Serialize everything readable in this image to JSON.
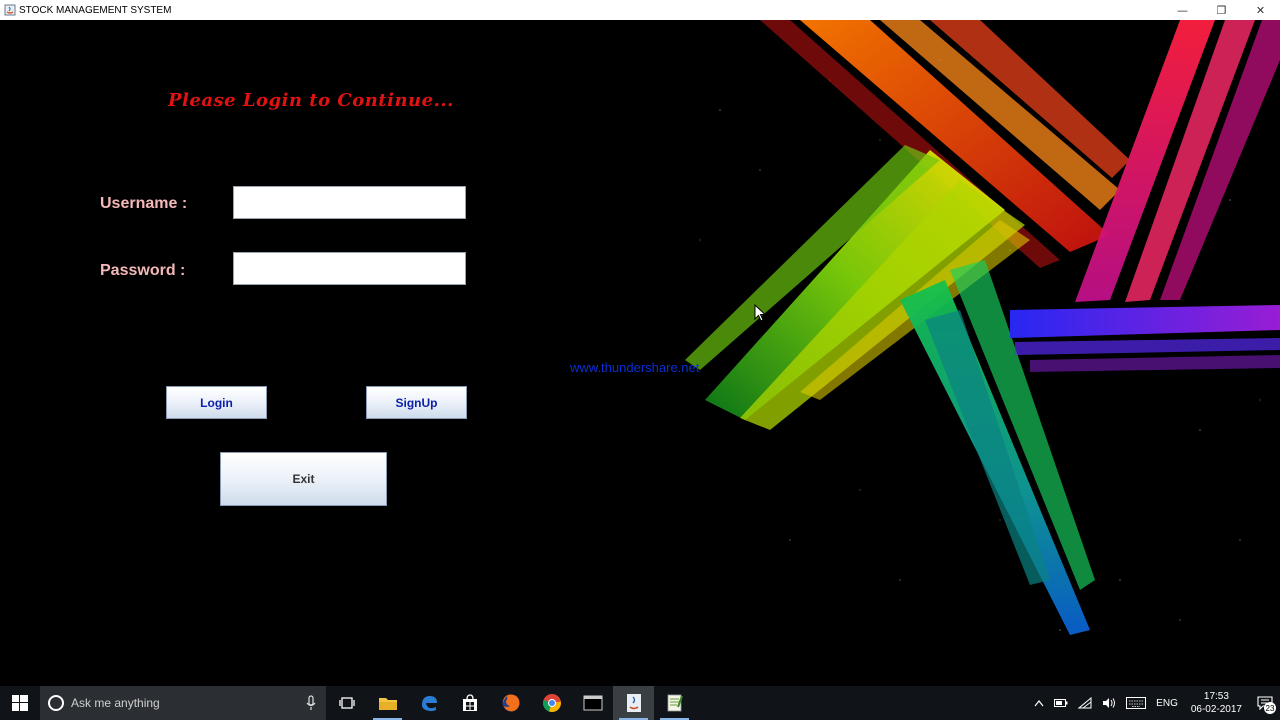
{
  "window": {
    "title": "STOCK MANAGEMENT SYSTEM",
    "minimize": "—",
    "restore": "❐",
    "close": "✕"
  },
  "login": {
    "heading": "Please Login to Continue...",
    "username_label": "Username :",
    "password_label": "Password :",
    "username_value": "",
    "password_value": "",
    "login_button": "Login",
    "signup_button": "SignUp",
    "exit_button": "Exit"
  },
  "watermark": "www.thundershare.net",
  "taskbar": {
    "search_placeholder": "Ask me anything",
    "apps": [
      "task-view",
      "file-explorer",
      "edge",
      "store",
      "firefox",
      "chrome",
      "terminal",
      "java",
      "notepad"
    ],
    "active_app": "java",
    "tray": {
      "language": "ENG",
      "time": "17:53",
      "date": "06-02-2017",
      "notification_count": "23"
    }
  },
  "colors": {
    "heading": "#e01212",
    "labels": "#f3b8b8",
    "button_text": "#0b1fa8",
    "watermark": "#0a2fd6"
  }
}
